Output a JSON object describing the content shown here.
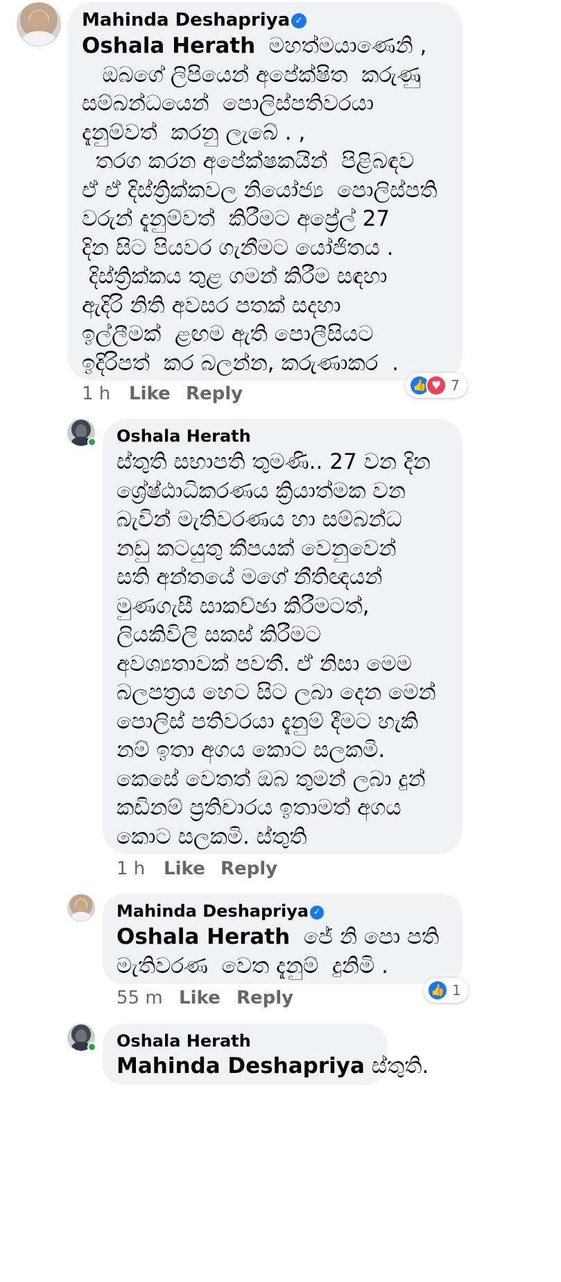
{
  "comments": [
    {
      "author": "Mahinda Deshapriya",
      "verified": true,
      "mention": "Oshala Herath",
      "first_line_rest": "  මහත්මයාණෙනි ,",
      "lines": [
        "   ඔබගේ ලිපියෙන් අපේක්ෂිත  කරුණු",
        "සම්බන්ධයෙන්  පොලිස්පතිවරයා",
        "දැනුම්වත්  කරනු ලැබේ . ,",
        "  තරග කරන අපේක්ෂකයින්  පිළිබඳව",
        "ඒ ඒ දිස්ත්‍රික්කවල නියෝජ්‍ය  පොලිස්පති",
        "වරුන් දැනුම්වත්  කිරීමට අප්‍රේල් 27",
        "දින සිට පියවර ගැනීමට යෝජිතය .",
        " දිස්ත්‍රික්කය තුළ ගමන් කිරීම සඳහා",
        "ඇදිරි නිති අවසර පතක් සදහා",
        "ඉල්ලීමක්  ළඟම ඇති පොලීසියට",
        "ඉදිරිපත්  කර බලන්න, කරුණාකර  ."
      ],
      "time": "1 h",
      "like": "Like",
      "reply": "Reply",
      "reaction_count": "7"
    },
    {
      "author": "Oshala Herath",
      "verified": false,
      "lines": [
        "ස්තුති සභාපති තුමණි.. 27 වන දින",
        "ශ්‍රේෂ්ඨාධිකරණය ක්‍රියාත්මක වන",
        "බැවින් මැතිවරණය හා සම්බන්ධ",
        "නඩු කටයුතු කීපයක් වෙනුවෙන්",
        "සති අන්තයේ මගේ නීතිඥයන්",
        "මුණගැසී සාකච්ඡා කිරීමටත්,",
        "ලියකිවිලි සකස් කිරීමට",
        "අවශ්‍යතාවක් පවතී. ඒ නිසා මෙම",
        "බලපත්‍රය හෙට සිට ලබා දෙන මෙන්",
        "පොලිස් පතිවරයා දැනුම් දීමට හැකි",
        "නම් ඉතා අගය කොට සලකමි.",
        "කෙසේ වෙතත් ඔබ තුමන් ලබා දුන්",
        "කඩිනම් ප්‍රතිචාරය ඉතාමත් අගය",
        "කොට සලකමි. ස්තුති"
      ],
      "time": "1 h",
      "like": "Like",
      "reply": "Reply"
    },
    {
      "author": "Mahinda Deshapriya",
      "verified": true,
      "mention": "Oshala Herath",
      "first_line_rest": "  ජේ නි පො පති",
      "lines": [
        "මැතිවරණ  වෙත දැනුම්  දුනිමි ."
      ],
      "time": "55 m",
      "like": "Like",
      "reply": "Reply",
      "reaction_count": "1"
    },
    {
      "author": "Oshala Herath",
      "verified": false,
      "mention": "Mahinda Deshapriya",
      "first_line_rest": " ස්තුති."
    }
  ]
}
